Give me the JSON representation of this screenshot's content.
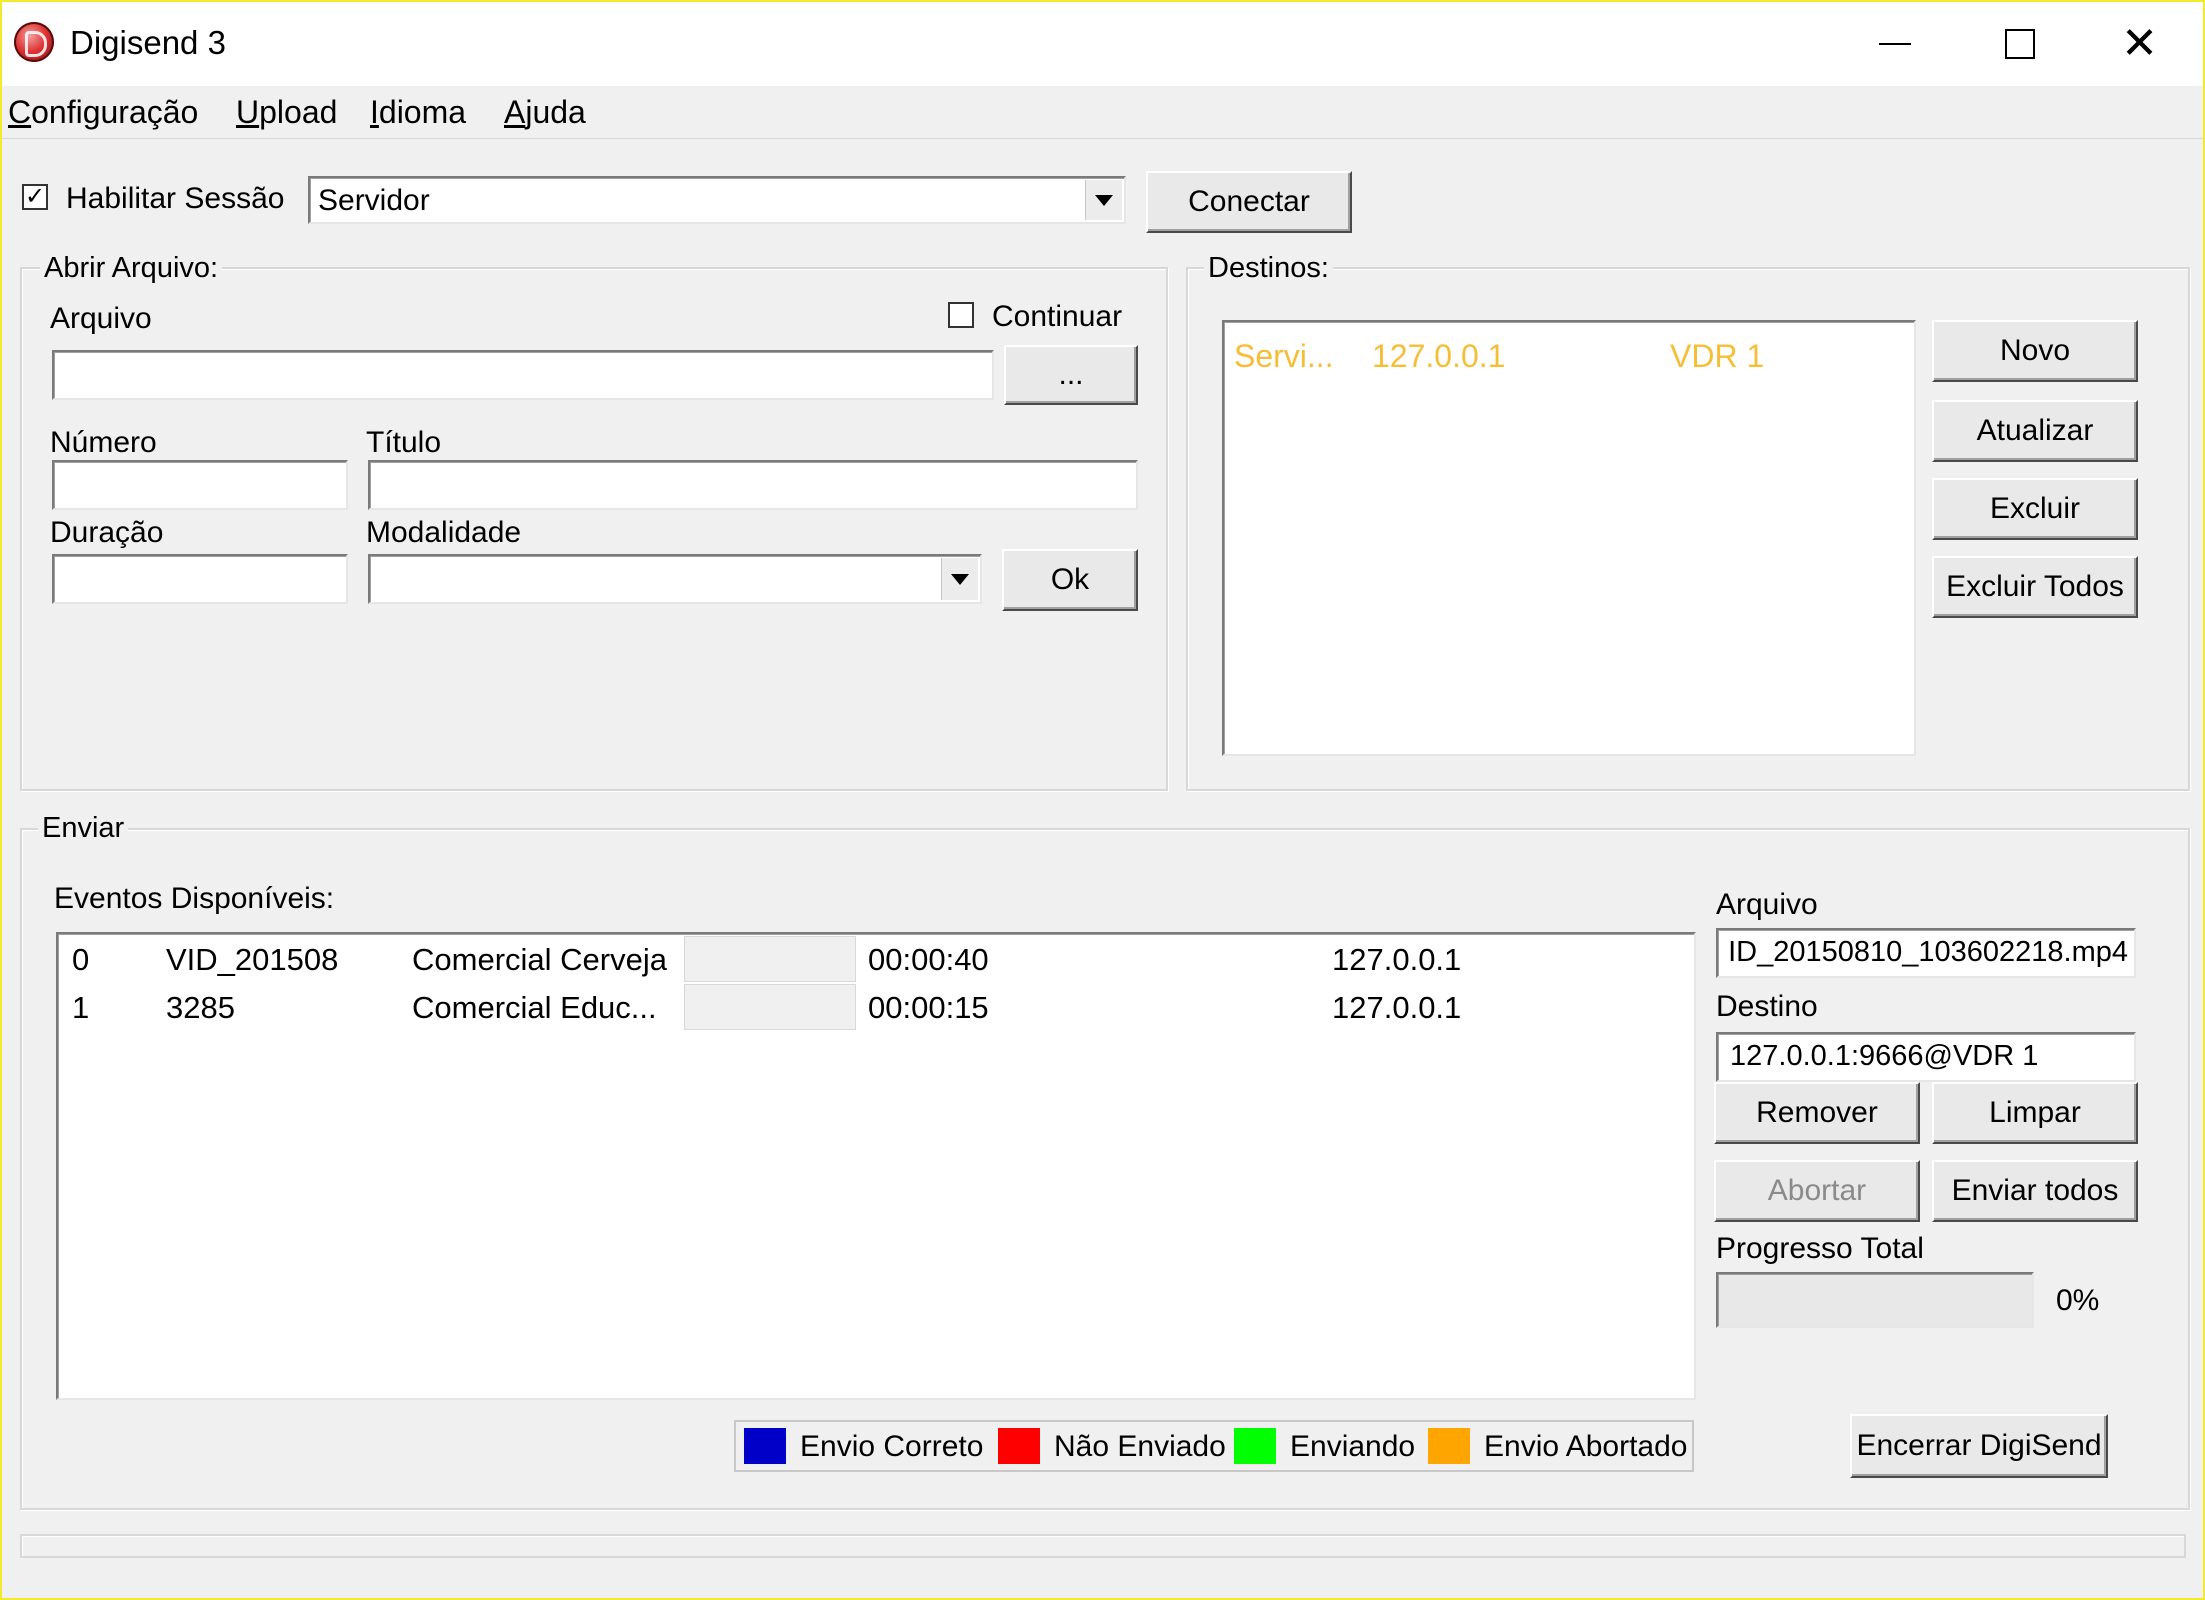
{
  "window": {
    "title": "Digisend 3",
    "minimize_icon": "minimize-icon",
    "maximize_icon": "maximize-icon",
    "close_glyph": "✕"
  },
  "menu": {
    "items": [
      {
        "label": "Configuração"
      },
      {
        "label": "Upload"
      },
      {
        "label": "Idioma"
      },
      {
        "label": "Ajuda"
      }
    ]
  },
  "session": {
    "enable_label": "Habilitar Sessão",
    "enable_checked": true,
    "check_glyph": "✓",
    "server_value": "Servidor",
    "connect_label": "Conectar"
  },
  "open_file": {
    "group_label": "Abrir Arquivo:",
    "file_label": "Arquivo",
    "continue_label": "Continuar",
    "continue_checked": false,
    "browse_label": "...",
    "number_label": "Número",
    "title_label": "Título",
    "duration_label": "Duração",
    "modality_label": "Modalidade",
    "ok_label": "Ok",
    "file_value": "",
    "number_value": "",
    "title_value": "",
    "duration_value": "",
    "modality_value": ""
  },
  "destinations": {
    "group_label": "Destinos:",
    "rows": [
      {
        "name": "Servi...",
        "ip": "127.0.0.1",
        "label": "VDR 1"
      }
    ],
    "new_label": "Novo",
    "update_label": "Atualizar",
    "delete_label": "Excluir",
    "delete_all_label": "Excluir Todos",
    "row_color": "#f6be36"
  },
  "send": {
    "group_label": "Enviar",
    "events_label": "Eventos Disponíveis:",
    "events": [
      {
        "index": "0",
        "file": "VID_201508",
        "title": "Comercial Cerveja",
        "duration": "00:00:40",
        "ip": "127.0.0.1"
      },
      {
        "index": "1",
        "file": "3285",
        "title": "Comercial Educ...",
        "duration": "00:00:15",
        "ip": "127.0.0.1"
      }
    ],
    "legend": [
      {
        "label": "Envio Correto",
        "color": "#0000c8"
      },
      {
        "label": "Não Enviado",
        "color": "#ff0000"
      },
      {
        "label": "Enviando",
        "color": "#00ff00"
      },
      {
        "label": "Envio Abortado",
        "color": "#ffa500"
      }
    ],
    "file_label": "Arquivo",
    "file_value": "ID_20150810_103602218.mp4",
    "dest_label": "Destino",
    "dest_value": "127.0.0.1:9666@VDR 1",
    "remove_label": "Remover",
    "clear_label": "Limpar",
    "abort_label": "Abortar",
    "send_all_label": "Enviar todos",
    "progress_label": "Progresso Total",
    "progress_text": "0%",
    "progress_value": 0,
    "exit_label": "Encerrar DigiSend"
  }
}
